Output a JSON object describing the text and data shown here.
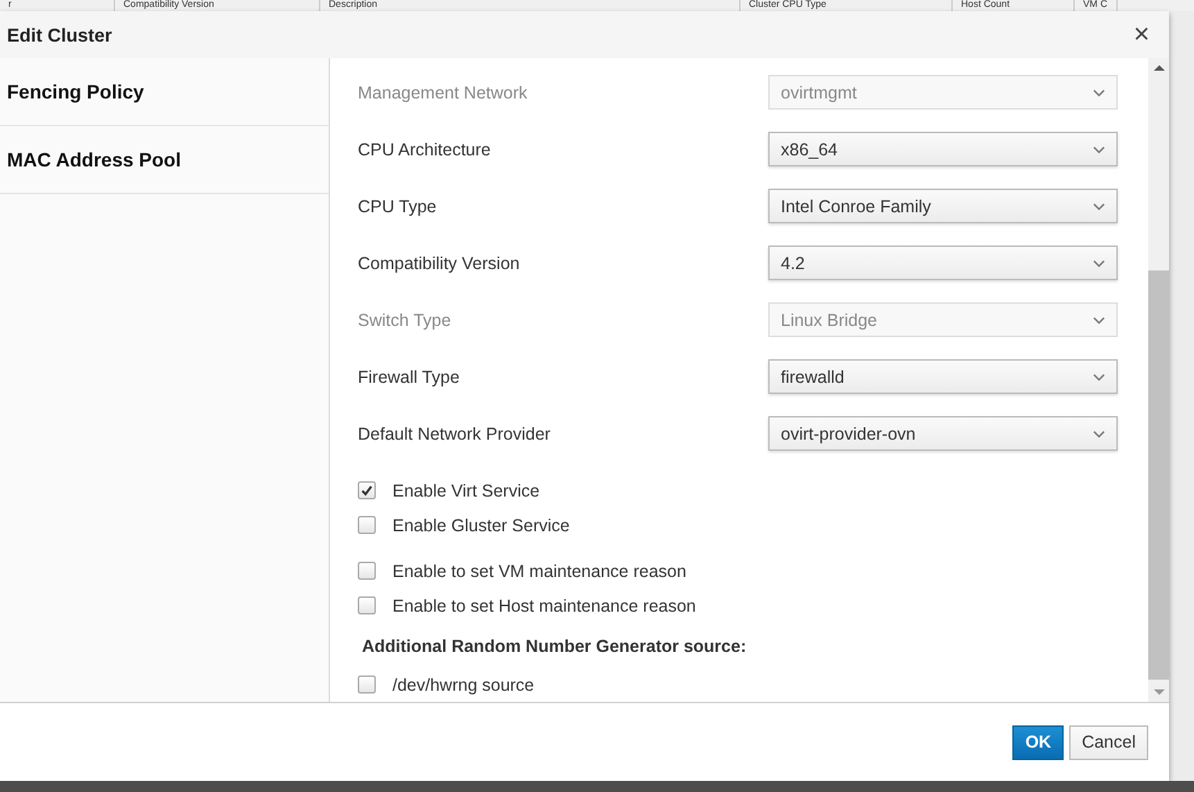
{
  "background_table": {
    "columns": [
      "r",
      "Compatibility Version",
      "Description",
      "Cluster CPU Type",
      "Host Count",
      "VM C"
    ]
  },
  "dialog": {
    "title": "Edit Cluster",
    "close": "×"
  },
  "sidebar": {
    "items": [
      {
        "label": "Fencing Policy"
      },
      {
        "label": "MAC Address Pool"
      }
    ]
  },
  "fields": [
    {
      "label": "Management Network",
      "value": "ovirtmgmt",
      "disabled": true
    },
    {
      "label": "CPU Architecture",
      "value": "x86_64",
      "disabled": false
    },
    {
      "label": "CPU Type",
      "value": "Intel Conroe Family",
      "disabled": false
    },
    {
      "label": "Compatibility Version",
      "value": "4.2",
      "disabled": false
    },
    {
      "label": "Switch Type",
      "value": "Linux Bridge",
      "disabled": true
    },
    {
      "label": "Firewall Type",
      "value": "firewalld",
      "disabled": false
    },
    {
      "label": "Default Network Provider",
      "value": "ovirt-provider-ovn",
      "disabled": false
    }
  ],
  "option_groups": [
    {
      "items": [
        {
          "label": "Enable Virt Service",
          "checked": true
        },
        {
          "label": "Enable Gluster Service",
          "checked": false
        }
      ]
    },
    {
      "items": [
        {
          "label": "Enable to set VM maintenance reason",
          "checked": false
        },
        {
          "label": "Enable to set Host maintenance reason",
          "checked": false
        }
      ]
    },
    {
      "heading": "Additional Random Number Generator source:",
      "items": [
        {
          "label": "/dev/hwrng source",
          "checked": false
        }
      ]
    }
  ],
  "buttons": [
    {
      "label": "OK",
      "kind": "primary"
    },
    {
      "label": "Cancel",
      "kind": "default"
    }
  ]
}
